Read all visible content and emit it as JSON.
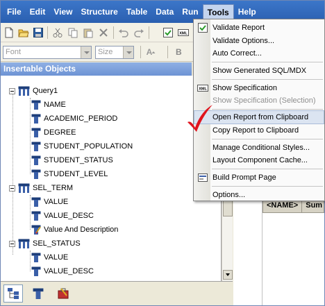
{
  "menubar": {
    "items": [
      {
        "label": "File"
      },
      {
        "label": "Edit"
      },
      {
        "label": "View"
      },
      {
        "label": "Structure"
      },
      {
        "label": "Table"
      },
      {
        "label": "Data"
      },
      {
        "label": "Run"
      },
      {
        "label": "Tools"
      },
      {
        "label": "Help"
      }
    ],
    "active": "Tools"
  },
  "format_toolbar": {
    "font_placeholder": "Font",
    "size_placeholder": "Size",
    "bold_label": "B"
  },
  "left_pane": {
    "title": "Insertable Objects",
    "tree": [
      {
        "label": "Query1",
        "type": "query",
        "children": [
          {
            "label": "NAME"
          },
          {
            "label": "ACADEMIC_PERIOD"
          },
          {
            "label": "DEGREE"
          },
          {
            "label": "STUDENT_POPULATION"
          },
          {
            "label": "STUDENT_STATUS"
          },
          {
            "label": "STUDENT_LEVEL"
          }
        ]
      },
      {
        "label": "SEL_TERM",
        "type": "query",
        "children": [
          {
            "label": "VALUE"
          },
          {
            "label": "VALUE_DESC"
          },
          {
            "label": "Value And Description"
          }
        ]
      },
      {
        "label": "SEL_STATUS",
        "type": "query",
        "children": [
          {
            "label": "VALUE"
          },
          {
            "label": "VALUE_DESC"
          }
        ]
      }
    ]
  },
  "report_grid": {
    "columns": [
      "<NAME>",
      "Sum"
    ]
  },
  "tools_menu": {
    "items": [
      {
        "label": "Validate Report",
        "icon": "validate-report-icon",
        "disabled": false
      },
      {
        "label": "Validate Options...",
        "disabled": false
      },
      {
        "label": "Auto Correct...",
        "disabled": false
      },
      {
        "label": "Show Generated SQL/MDX",
        "disabled": false
      },
      {
        "label": "Show Specification",
        "icon": "xml-icon",
        "disabled": false
      },
      {
        "label": "Show Specification (Selection)",
        "disabled": true
      },
      {
        "label": "Open Report from Clipboard",
        "disabled": false,
        "highlighted": true
      },
      {
        "label": "Copy Report to Clipboard",
        "disabled": false
      },
      {
        "label": "Manage Conditional Styles...",
        "disabled": false
      },
      {
        "label": "Layout Component Cache...",
        "disabled": false
      },
      {
        "label": "Build Prompt Page",
        "icon": "build-prompt-icon",
        "disabled": false
      },
      {
        "label": "Options...",
        "disabled": false
      }
    ]
  },
  "colors": {
    "menubar": "#2a5fb0",
    "panel_header": "#6d93d4",
    "checkmark": "#e0141e",
    "highlight": "#dbe4f1"
  }
}
